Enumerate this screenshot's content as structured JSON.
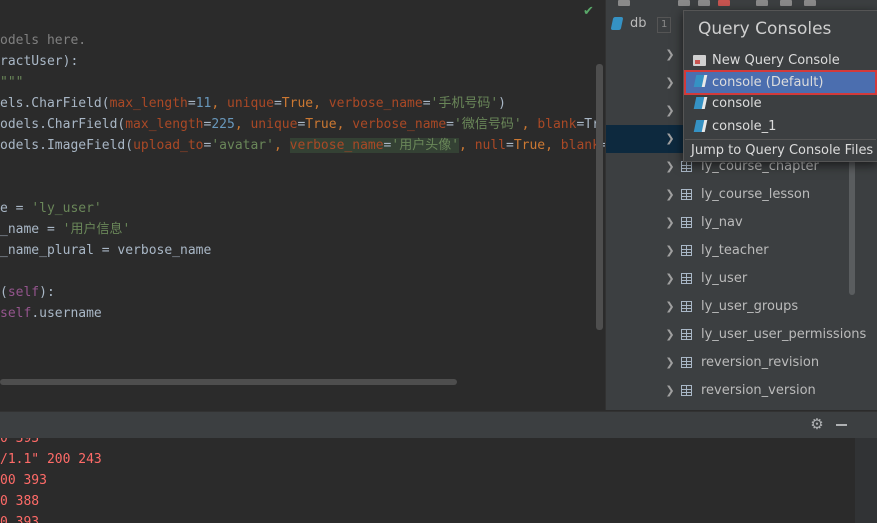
{
  "editor": {
    "lines": [
      [
        {
          "t": "odels here.",
          "c": "cmt"
        }
      ],
      [
        {
          "t": "ractUser",
          "c": ""
        },
        {
          "t": "):",
          "c": ""
        }
      ],
      [
        {
          "t": "\"\"\"",
          "c": "str"
        }
      ],
      [
        {
          "t": "els.CharField(",
          "c": ""
        },
        {
          "t": "max_length",
          "c": "param"
        },
        {
          "t": "=",
          "c": ""
        },
        {
          "t": "11",
          "c": "num"
        },
        {
          "t": ", ",
          "c": "kw"
        },
        {
          "t": "unique",
          "c": "param"
        },
        {
          "t": "=",
          "c": ""
        },
        {
          "t": "True",
          "c": "kw"
        },
        {
          "t": ", ",
          "c": "kw"
        },
        {
          "t": "verbose_name",
          "c": "param"
        },
        {
          "t": "=",
          "c": ""
        },
        {
          "t": "'手机号码'",
          "c": "str"
        },
        {
          "t": ")",
          "c": ""
        }
      ],
      [
        {
          "t": "odels.CharField(",
          "c": ""
        },
        {
          "t": "max_length",
          "c": "param"
        },
        {
          "t": "=",
          "c": ""
        },
        {
          "t": "225",
          "c": "num"
        },
        {
          "t": ", ",
          "c": "kw"
        },
        {
          "t": "unique",
          "c": "param"
        },
        {
          "t": "=",
          "c": ""
        },
        {
          "t": "True",
          "c": "kw"
        },
        {
          "t": ", ",
          "c": "kw"
        },
        {
          "t": "verbose_name",
          "c": "param"
        },
        {
          "t": "=",
          "c": ""
        },
        {
          "t": "'微信号码'",
          "c": "str"
        },
        {
          "t": ", ",
          "c": "kw"
        },
        {
          "t": "blank",
          "c": "param"
        },
        {
          "t": "=Tr",
          "c": ""
        }
      ],
      [
        {
          "t": "odels.ImageField(",
          "c": ""
        },
        {
          "t": "upload_to",
          "c": "param"
        },
        {
          "t": "=",
          "c": ""
        },
        {
          "t": "'avatar'",
          "c": "str"
        },
        {
          "t": ", ",
          "c": "kw"
        },
        {
          "t": "verbose_name",
          "c": "param hl"
        },
        {
          "t": "=",
          "c": "hl"
        },
        {
          "t": "'用户头像'",
          "c": "str hl"
        },
        {
          "t": ", ",
          "c": "kw"
        },
        {
          "t": "null",
          "c": "param"
        },
        {
          "t": "=",
          "c": ""
        },
        {
          "t": "True",
          "c": "kw"
        },
        {
          "t": ", ",
          "c": "kw"
        },
        {
          "t": "blank",
          "c": "param"
        },
        {
          "t": "=",
          "c": ""
        }
      ],
      [],
      [],
      [
        {
          "t": "e = ",
          "c": ""
        },
        {
          "t": "'ly_user'",
          "c": "str"
        }
      ],
      [
        {
          "t": "_name = ",
          "c": ""
        },
        {
          "t": "'用户信息'",
          "c": "str"
        }
      ],
      [
        {
          "t": "_name_plural = verbose_name",
          "c": ""
        }
      ],
      [],
      [
        {
          "t": "(",
          "c": ""
        },
        {
          "t": "self",
          "c": "sf"
        },
        {
          "t": "):",
          "c": ""
        }
      ],
      [
        {
          "t": "self",
          "c": "sf"
        },
        {
          "t": ".username",
          "c": ""
        }
      ]
    ]
  },
  "db_panel": {
    "db_name": "db",
    "db_count": "1",
    "tables": [
      {
        "name": "ly_course_chapter"
      },
      {
        "name": "ly_course_lesson"
      },
      {
        "name": "ly_nav"
      },
      {
        "name": "ly_teacher"
      },
      {
        "name": "ly_user"
      },
      {
        "name": "ly_user_groups"
      },
      {
        "name": "ly_user_user_permissions"
      },
      {
        "name": "reversion_revision"
      },
      {
        "name": "reversion_version"
      }
    ]
  },
  "query_consoles_popup": {
    "title": "Query Consoles",
    "new_console": "New Query Console",
    "consoles": [
      "console (Default)",
      "console",
      "console_1"
    ],
    "selected": "console (Default)",
    "jump": "Jump to Query Console Files"
  },
  "output": {
    "lines": [
      "0 393",
      "/1.1\" 200 243",
      "00 393",
      "0 388",
      "0 393"
    ]
  }
}
